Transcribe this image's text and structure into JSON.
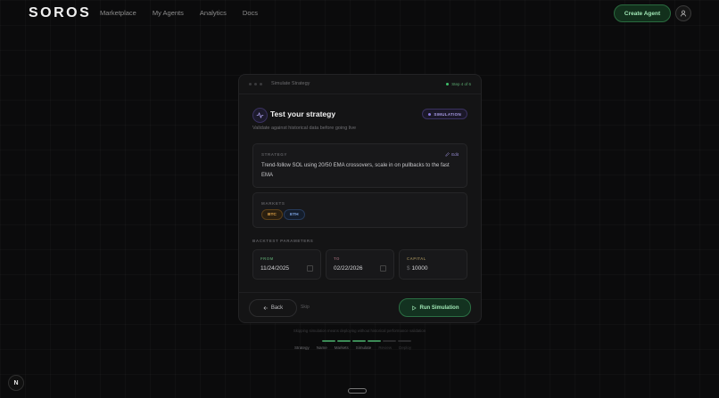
{
  "nav": {
    "logo": "SOROS",
    "links": [
      "Marketplace",
      "My Agents",
      "Analytics",
      "Docs"
    ],
    "create_label": "Create Agent"
  },
  "card": {
    "window_title": "Simulate Strategy",
    "step": "Step 4 of 6",
    "heading": "Test your strategy",
    "badge": "SIMULATION",
    "subtitle": "Validate against historical data before going live",
    "strategy_label": "STRATEGY",
    "edit_label": "Edit",
    "strategy_text": "Trend-follow SOL using 20/50 EMA crossovers, scale in on pullbacks to the fast EMA",
    "markets_label": "MARKETS",
    "markets": [
      "BTC",
      "ETH"
    ],
    "params_label": "BACKTEST PARAMETERS",
    "from_label": "FROM",
    "from_value": "11/24/2025",
    "to_label": "TO",
    "to_value": "02/22/2026",
    "capital_label": "CAPITAL",
    "capital_currency": "$",
    "capital_value": "10000",
    "back_label": "Back",
    "skip_label": "Skip",
    "run_label": "Run Simulation"
  },
  "footer": {
    "hint": "Skipping simulation means deploying without historical performance validation",
    "steps": [
      "Strategy",
      "Name",
      "Markets",
      "Simulate",
      "Review",
      "Deploy"
    ],
    "completed_steps": 4
  },
  "corner_badge": "N",
  "colors": {
    "accent_green": "#2a6b3f",
    "accent_purple": "#8b7be0",
    "btc": "#e3a64a",
    "eth": "#7ea6e6"
  }
}
